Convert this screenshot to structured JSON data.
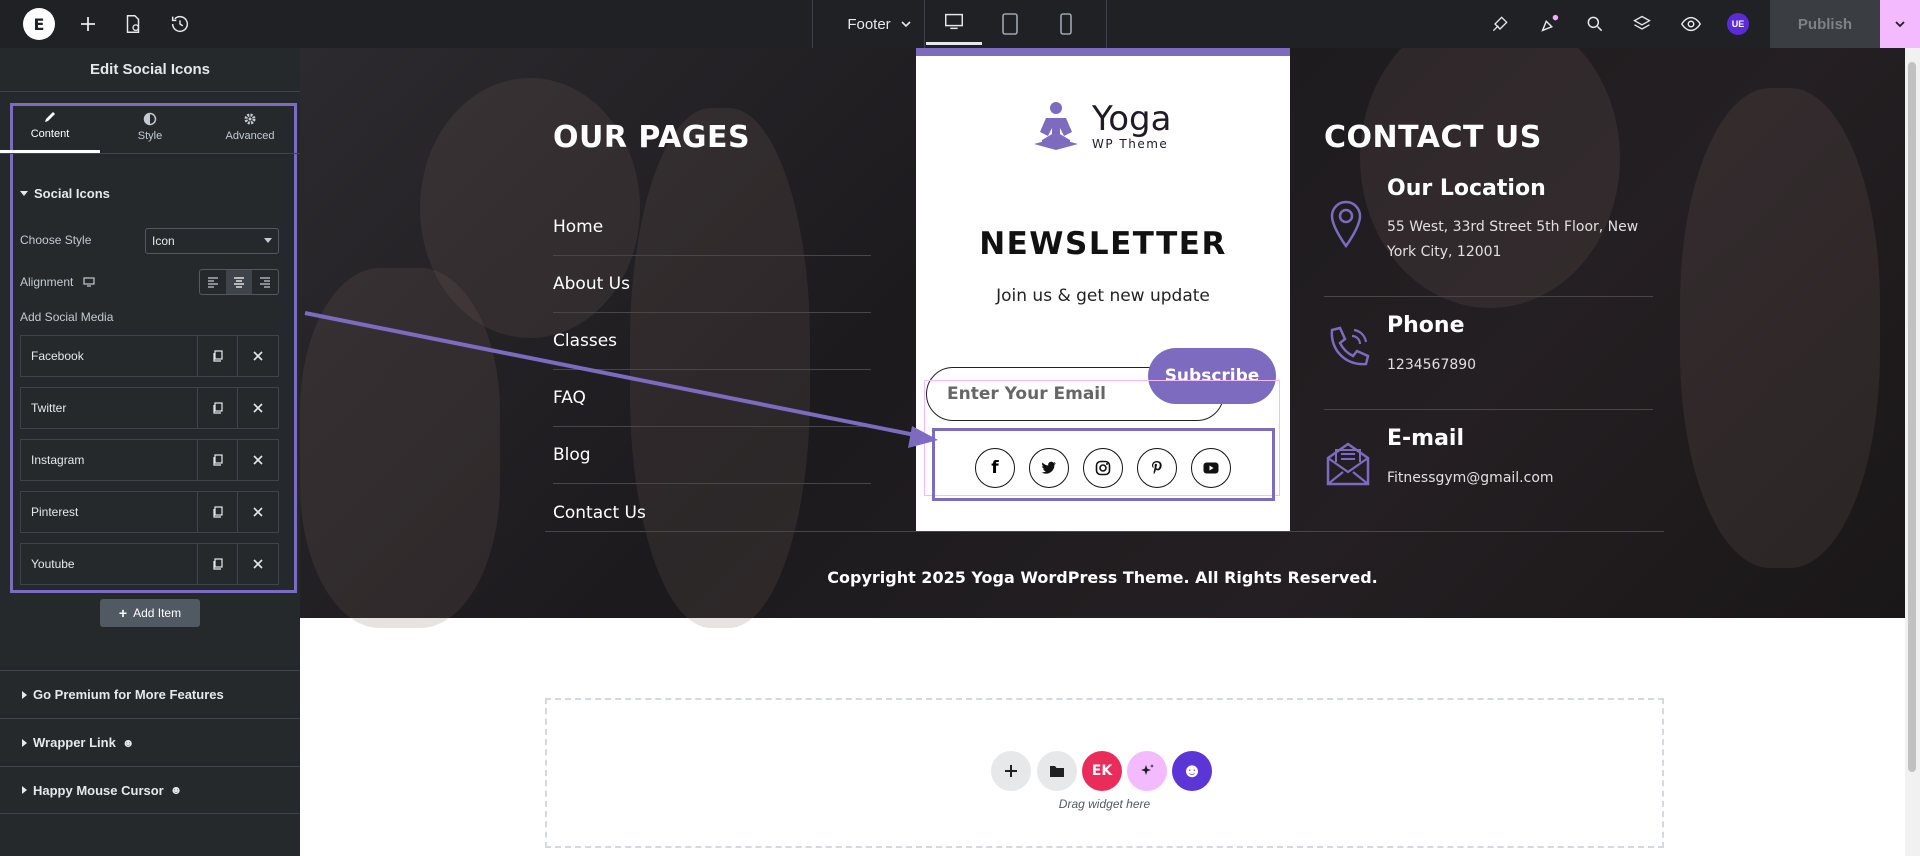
{
  "topbar": {
    "logo_text": "E",
    "document_name": "Footer",
    "publish_label": "Publish",
    "avatar_initials": "UE",
    "icons": [
      "plus-icon",
      "page-settings-icon",
      "history-icon",
      "chevron-down-icon",
      "desktop-icon",
      "tablet-icon",
      "mobile-icon",
      "site-settings-icon",
      "notifications-icon",
      "search-icon",
      "structure-icon",
      "preview-icon"
    ],
    "colors": {
      "bar": "#1f2124",
      "publish_menu": "#f3bafd",
      "avatar": "#5b2bd9"
    }
  },
  "panel": {
    "title": "Edit Social Icons",
    "tabs": [
      {
        "label": "Content",
        "icon": "pencil-icon",
        "active": true
      },
      {
        "label": "Style",
        "icon": "half-circle-icon",
        "active": false
      },
      {
        "label": "Advanced",
        "icon": "gear-icon",
        "active": false
      }
    ],
    "section_title": "Social Icons",
    "choose_style_label": "Choose Style",
    "choose_style_value": "Icon",
    "alignment_label": "Alignment",
    "add_social_label": "Add Social Media",
    "social_items": [
      {
        "label": "Facebook"
      },
      {
        "label": "Twitter"
      },
      {
        "label": "Instagram"
      },
      {
        "label": "Pinterest"
      },
      {
        "label": "Youtube"
      }
    ],
    "add_item_label": "Add Item",
    "accordions": [
      {
        "label": "Go Premium for More Features"
      },
      {
        "label": "Wrapper Link"
      },
      {
        "label": "Happy Mouse Cursor"
      }
    ]
  },
  "footer": {
    "pages_heading": "OUR PAGES",
    "pages": [
      "Home",
      "About Us",
      "Classes",
      "FAQ",
      "Blog",
      "Contact Us"
    ],
    "brand_name": "Yoga",
    "brand_tagline": "WP Theme",
    "newsletter_heading": "NEWSLETTER",
    "newsletter_sub": "Join us & get new update",
    "email_placeholder": "Enter Your Email",
    "subscribe_label": "Subscribe",
    "social_icons": [
      "facebook-icon",
      "twitter-icon",
      "instagram-icon",
      "pinterest-icon",
      "youtube-icon"
    ],
    "contact_heading": "CONTACT US",
    "contacts": [
      {
        "title": "Our Location",
        "text": "55 West, 33rd Street 5th Floor, New York City, 12001",
        "icon": "location-pin-icon"
      },
      {
        "title": "Phone",
        "text": "1234567890",
        "icon": "phone-icon"
      },
      {
        "title": "E-mail",
        "text": "Fitnessgym@gmail.com",
        "icon": "envelope-icon"
      }
    ],
    "copyright": "Copyright 2025 Yoga WordPress Theme. All Rights Reserved.",
    "accent_color": "#7d6bbf"
  },
  "dropzone": {
    "hint": "Drag widget here",
    "buttons": [
      "add-section-icon",
      "template-library-icon",
      "elementskit-icon",
      "ai-sparkle-icon",
      "happy-addons-icon"
    ]
  }
}
